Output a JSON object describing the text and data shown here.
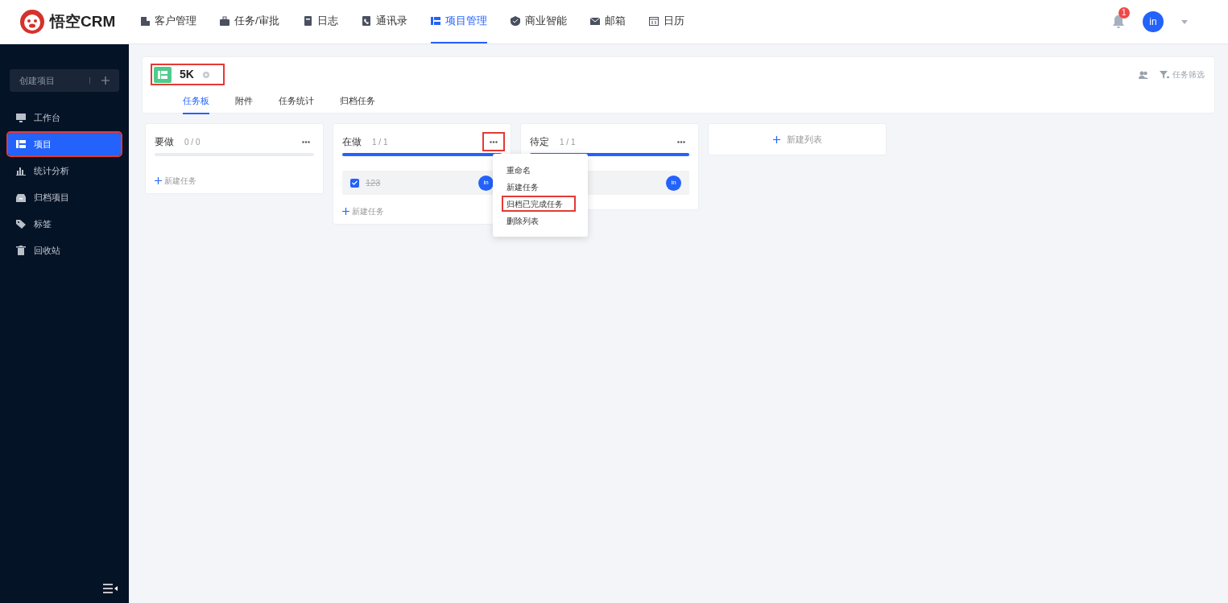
{
  "logo": {
    "text": "悟空CRM"
  },
  "nav": [
    {
      "label": "客户管理",
      "selected": false
    },
    {
      "label": "任务/审批",
      "selected": false
    },
    {
      "label": "日志",
      "selected": false
    },
    {
      "label": "通讯录",
      "selected": false
    },
    {
      "label": "项目管理",
      "selected": true
    },
    {
      "label": "商业智能",
      "selected": false
    },
    {
      "label": "邮箱",
      "selected": false
    },
    {
      "label": "日历",
      "selected": false
    }
  ],
  "notifications": {
    "count": "1"
  },
  "user": {
    "avatar": "in"
  },
  "sidebar": {
    "create_button": "创建项目",
    "items": [
      {
        "label": "工作台",
        "selected": false,
        "highlighted": false
      },
      {
        "label": "项目",
        "selected": true,
        "highlighted": true
      },
      {
        "label": "统计分析",
        "selected": false,
        "highlighted": false
      },
      {
        "label": "归档项目",
        "selected": false,
        "highlighted": false
      },
      {
        "label": "标签",
        "selected": false,
        "highlighted": false
      },
      {
        "label": "回收站",
        "selected": false,
        "highlighted": false
      }
    ]
  },
  "project": {
    "name": "5K",
    "highlighted": true,
    "filter_label": "任务筛选",
    "tabs": [
      {
        "label": "任务板",
        "selected": true
      },
      {
        "label": "附件",
        "selected": false
      },
      {
        "label": "任务统计",
        "selected": false
      },
      {
        "label": "归档任务",
        "selected": false
      }
    ]
  },
  "columns": [
    {
      "title": "要做",
      "count": "0 / 0",
      "level": 0,
      "menu_highlighted": false,
      "add_task": "新建任务"
    },
    {
      "title": "在做",
      "count": "1 / 1",
      "level": 1,
      "menu_highlighted": true,
      "tasks": [
        {
          "title": "123",
          "checked": true,
          "avatar": "in"
        }
      ],
      "add_task": "新建任务"
    },
    {
      "title": "待定",
      "count": "1 / 1",
      "level": 1,
      "menu_highlighted": false,
      "tasks": [
        {
          "avatar": "in"
        }
      ]
    }
  ],
  "new_list": "新建列表",
  "column_menu": {
    "items": [
      {
        "label": "重命名",
        "highlighted": false
      },
      {
        "label": "新建任务",
        "highlighted": false
      },
      {
        "label": "归档已完成任务",
        "highlighted": true
      },
      {
        "label": "删除列表",
        "highlighted": false
      }
    ]
  }
}
